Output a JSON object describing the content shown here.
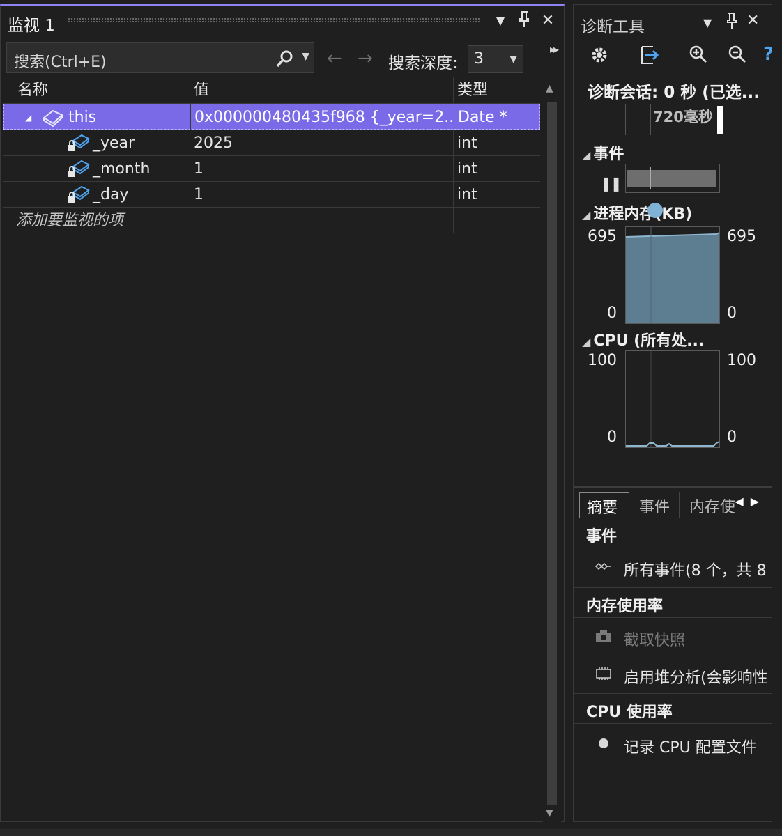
{
  "watch": {
    "title": "监视 1",
    "search_placeholder": "搜索(Ctrl+E)",
    "search_depth_label": "搜索深度:",
    "search_depth_value": "3",
    "columns": {
      "name": "名称",
      "value": "值",
      "type": "类型"
    },
    "rows": [
      {
        "name": "this",
        "value": "0x000000480435f968 {_year=2...",
        "type": "Date *"
      },
      {
        "name": "_year",
        "value": "2025",
        "type": "int"
      },
      {
        "name": "_month",
        "value": "1",
        "type": "int"
      },
      {
        "name": "_day",
        "value": "1",
        "type": "int"
      }
    ],
    "add_item_placeholder": "添加要监视的项"
  },
  "diag": {
    "title": "诊断工具",
    "session": "诊断会话: 0 秒 (已选...",
    "timeline_label": "720毫秒",
    "events_title": "事件",
    "memory_title": "进程内存(KB)",
    "memory_max_left": "695",
    "memory_min_left": "0",
    "memory_max_right": "695",
    "memory_min_right": "0",
    "cpu_title": "CPU (所有处...",
    "cpu_max_left": "100",
    "cpu_min_left": "0",
    "cpu_max_right": "100",
    "cpu_min_right": "0",
    "tabs": [
      "摘要",
      "事件",
      "内存使"
    ],
    "summary": {
      "events_header": "事件",
      "all_events": "所有事件(8 个，共 8",
      "memory_header": "内存使用率",
      "snapshot": "截取快照",
      "heap": "启用堆分析(会影响性",
      "cpu_header": "CPU 使用率",
      "record_cpu": "记录 CPU 配置文件"
    }
  },
  "colors": {
    "accent": "#7a6ae8",
    "memory_fill": "#5d7d91"
  }
}
